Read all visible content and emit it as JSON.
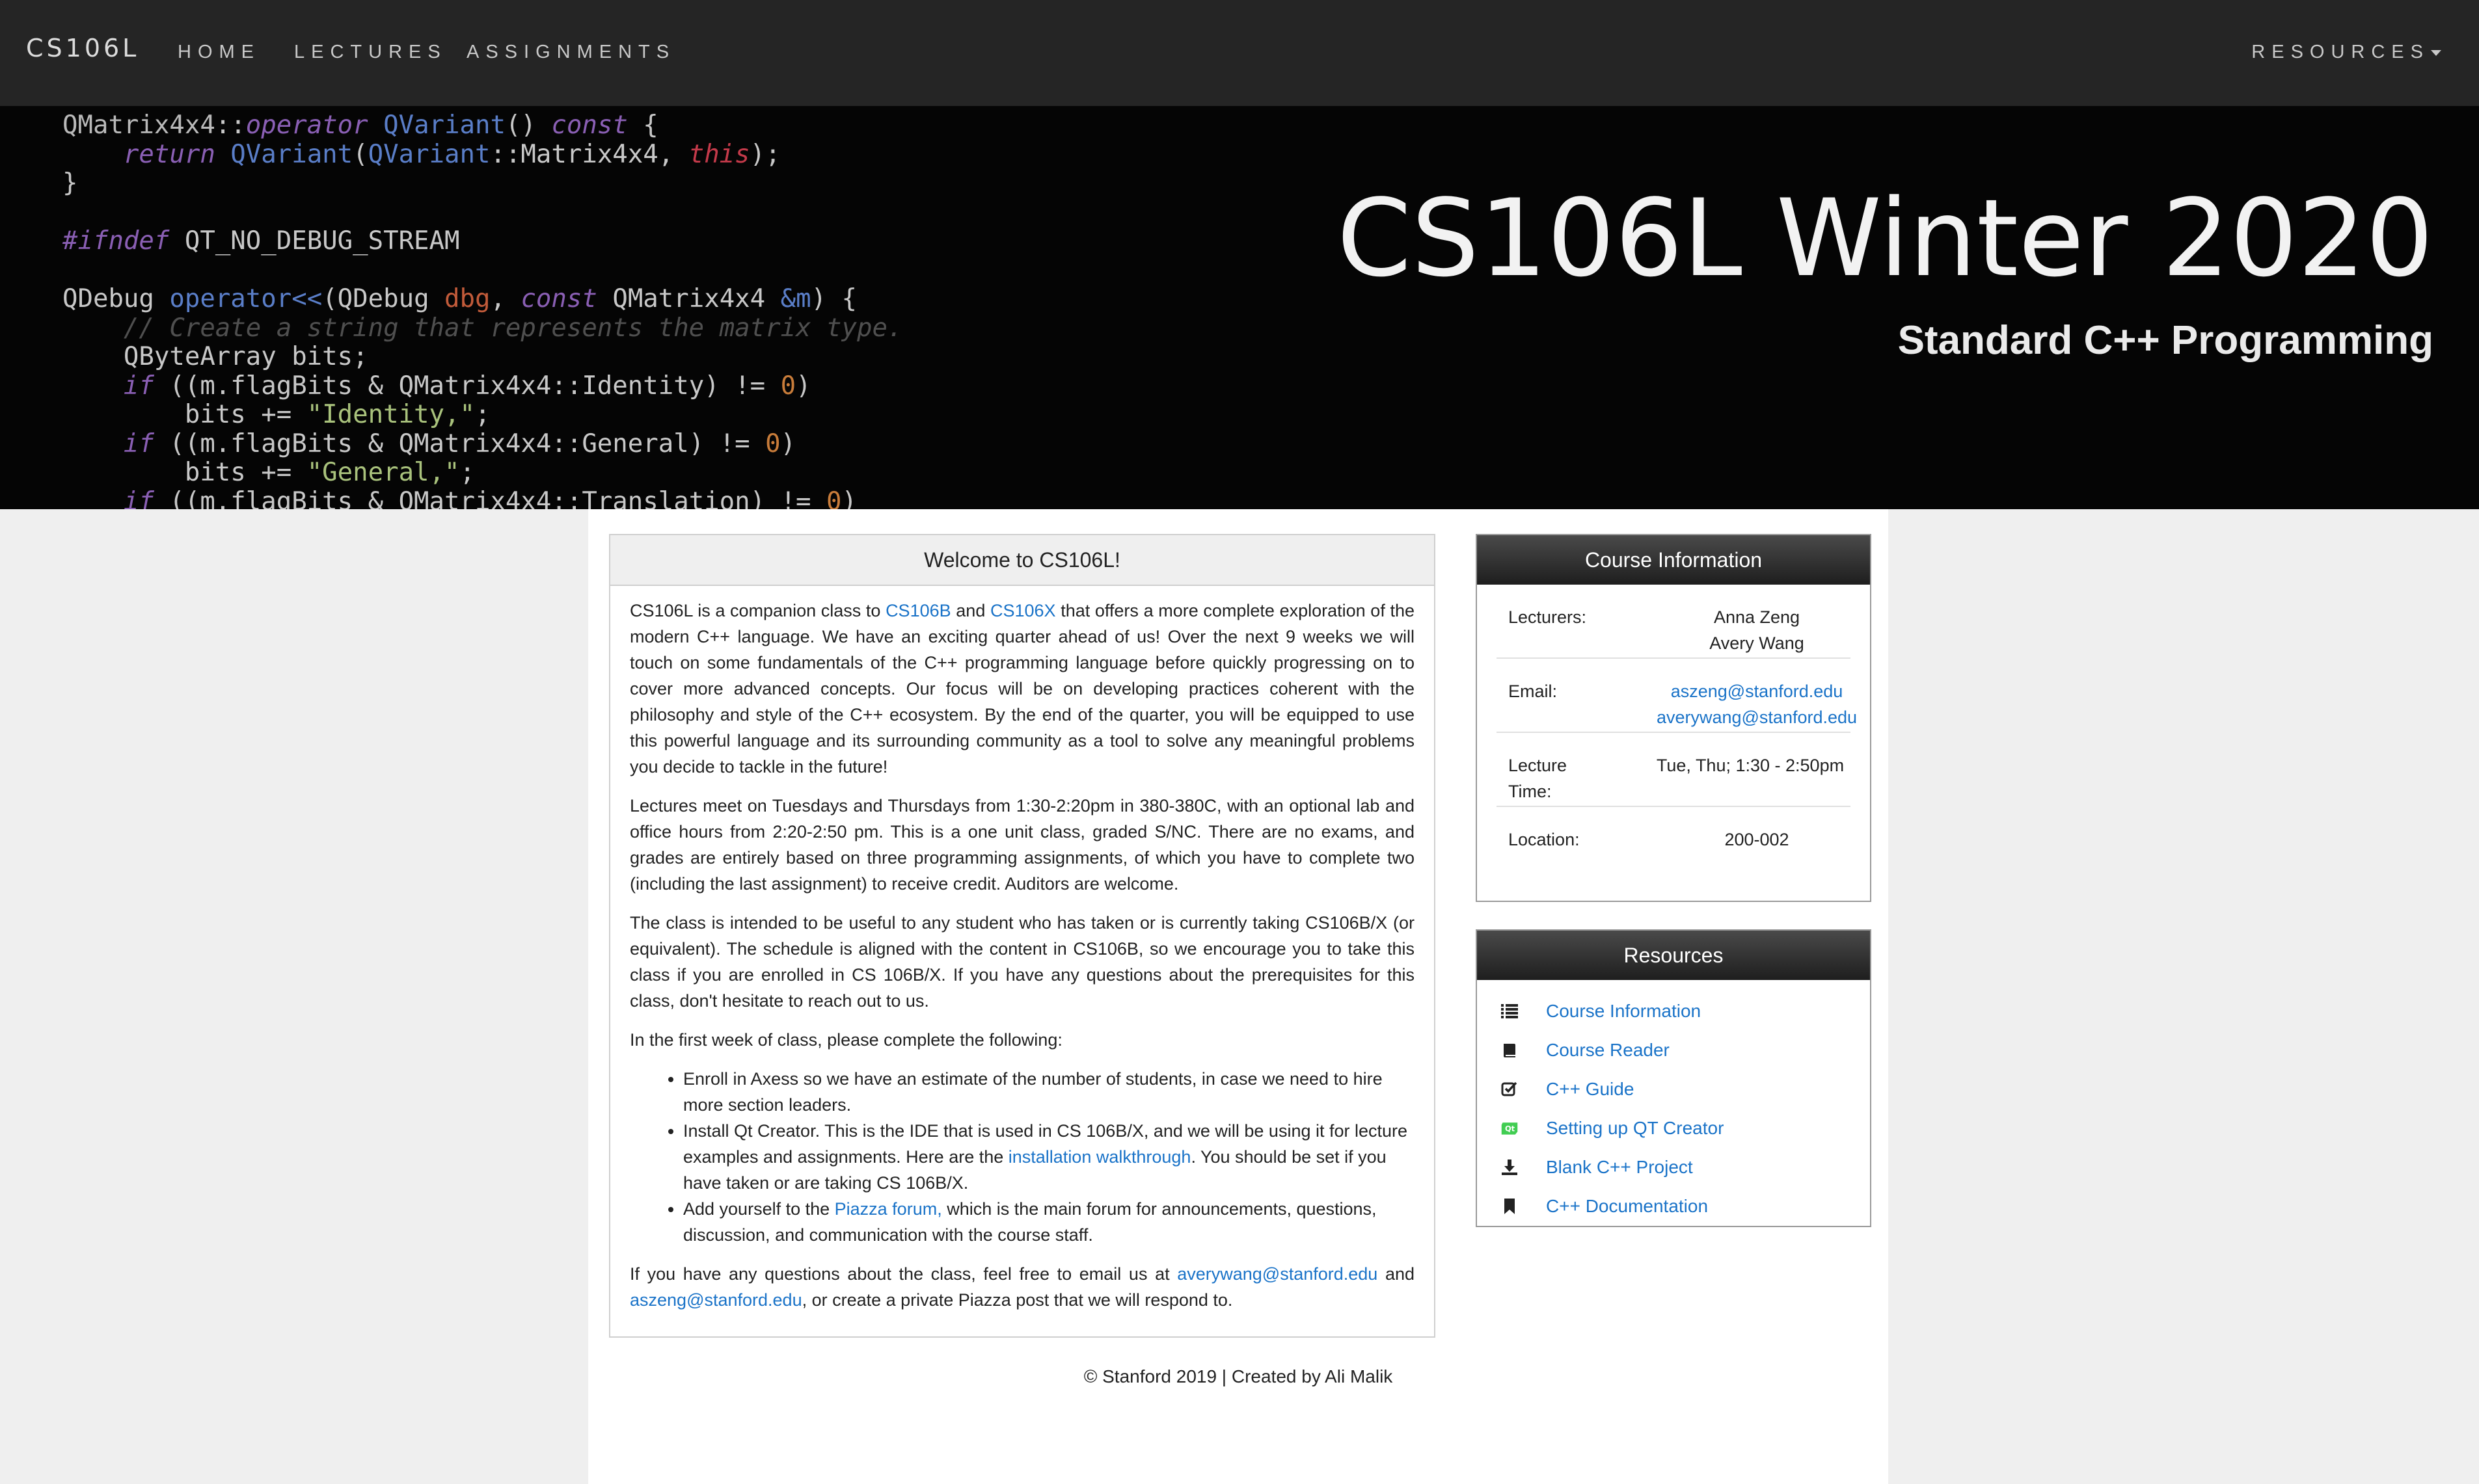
{
  "nav": {
    "brand": "CS106L",
    "items": [
      "HOME",
      "LECTURES",
      "ASSIGNMENTS"
    ],
    "resources": "RESOURCES"
  },
  "hero": {
    "title": "CS106L Winter 2020",
    "subtitle": "Standard C++ Programming"
  },
  "welcome": {
    "heading": "Welcome to CS106L!",
    "p1": {
      "a": "CS106L is a companion class to ",
      "link1": "CS106B",
      "b": " and ",
      "link2": "CS106X",
      "c": " that offers a more complete exploration of the modern C++ language. We have an exciting quarter ahead of us! Over the next 9 weeks we will touch on some fundamentals of the C++ programming language before quickly progressing on to cover more advanced concepts. Our focus will be on developing practices coherent with the philosophy and style of the C++ ecosystem. By the end of the quarter, you will be equipped to use this powerful language and its surrounding community as a tool to solve any meaningful problems you decide to tackle in the future!"
    },
    "p2": "Lectures meet on Tuesdays and Thursdays from 1:30-2:20pm in 380-380C, with an optional lab and office hours from 2:20-2:50 pm. This is a one unit class, graded S/NC. There are no exams, and grades are entirely based on three programming assignments, of which you have to complete two (including the last assignment) to receive credit. Auditors are welcome.",
    "p3": "The class is intended to be useful to any student who has taken or is currently taking CS106B/X (or equivalent). The schedule is aligned with the content in CS106B, so we encourage you to take this class if you are enrolled in CS 106B/X. If you have any questions about the prerequisites for this class, don't hesitate to reach out to us.",
    "p4": "In the first week of class, please complete the following:",
    "li1": "Enroll in Axess so we have an estimate of the number of students, in case we need to hire more section leaders.",
    "li2": {
      "a": "Install Qt Creator. This is the IDE that is used in CS 106B/X, and we will be using it for lecture examples and assignments. Here are the ",
      "link": "installation walkthrough",
      "b": ". You should be set if you have taken or are taking CS 106B/X."
    },
    "li3": {
      "a": "Add yourself to the ",
      "link": "Piazza forum,",
      "b": " which is the main forum for announcements, questions, discussion, and communication with the course staff."
    },
    "p5": {
      "a": "If you have any questions about the class, feel free to email us at ",
      "link1": "averywang@stanford.edu",
      "b": " and ",
      "link2": "aszeng@stanford.edu",
      "c": ", or create a private Piazza post that we will respond to."
    }
  },
  "course_info": {
    "heading": "Course Information",
    "rows": [
      {
        "label": "Lecturers:",
        "values": [
          "Anna Zeng",
          "Avery Wang"
        ]
      },
      {
        "label": "Email:",
        "values": [
          "aszeng@stanford.edu",
          "averywang@stanford.edu"
        ]
      },
      {
        "label": "Lecture Time:",
        "values": [
          "Tue, Thu; 1:30 - 2:50pm"
        ]
      },
      {
        "label": "Location:",
        "values": [
          "200-002"
        ]
      }
    ]
  },
  "resources": {
    "heading": "Resources",
    "items": [
      {
        "label": "Course Information",
        "icon": "list-icon"
      },
      {
        "label": "Course Reader",
        "icon": "book-icon"
      },
      {
        "label": "C++ Guide",
        "icon": "check-square-icon"
      },
      {
        "label": "Setting up QT Creator",
        "icon": "qt-logo-icon"
      },
      {
        "label": "Blank C++ Project",
        "icon": "download-icon"
      },
      {
        "label": "C++ Documentation",
        "icon": "bookmark-icon"
      }
    ]
  },
  "footer": "© Stanford 2019 | Created by Ali Malik",
  "colors": {
    "link": "#1a73c8",
    "navbar": "#252525",
    "hero_bg": "#050505",
    "qt_green": "#41cd52"
  }
}
